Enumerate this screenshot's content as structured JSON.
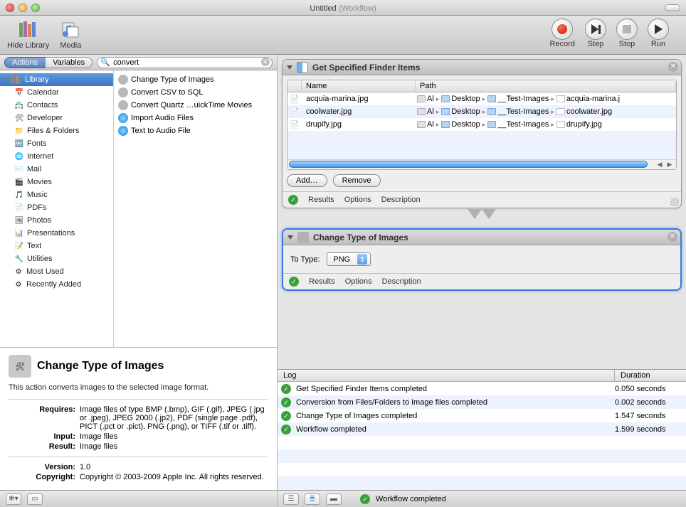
{
  "window": {
    "title": "Untitled",
    "subtitle": "(Workflow)"
  },
  "toolbar": {
    "hide_library": "Hide Library",
    "media": "Media",
    "record": "Record",
    "step": "Step",
    "stop": "Stop",
    "run": "Run"
  },
  "library_tabs": {
    "actions": "Actions",
    "variables": "Variables"
  },
  "search": {
    "placeholder": "",
    "value": "convert"
  },
  "categories": {
    "root": "Library",
    "items": [
      "Calendar",
      "Contacts",
      "Developer",
      "Files & Folders",
      "Fonts",
      "Internet",
      "Mail",
      "Movies",
      "Music",
      "PDFs",
      "Photos",
      "Presentations",
      "Text",
      "Utilities"
    ],
    "most_used": "Most Used",
    "recent": "Recently Added"
  },
  "actions_list": [
    "Change Type of Images",
    "Convert CSV to SQL",
    "Convert Quartz …uickTime Movies",
    "Import Audio Files",
    "Text to Audio File"
  ],
  "detail": {
    "title": "Change Type of Images",
    "desc": "This action converts images to the selected image format.",
    "requires_label": "Requires:",
    "requires": "Image files of type BMP (.bmp), GIF (.gif), JPEG (.jpg or .jpeg), JPEG 2000 (.jp2), PDF (single page .pdf), PICT (.pct or .pict), PNG (.png), or TIFF (.tif or .tiff).",
    "input_label": "Input:",
    "input": "Image files",
    "result_label": "Result:",
    "result": "Image files",
    "version_label": "Version:",
    "version": "1.0",
    "copyright_label": "Copyright:",
    "copyright": "Copyright © 2003-2009 Apple Inc.  All rights reserved."
  },
  "workflow": {
    "step1": {
      "title": "Get Specified Finder Items",
      "cols": {
        "name": "Name",
        "path": "Path"
      },
      "rows": [
        {
          "name": "acquia-marina.jpg",
          "path": [
            "Al",
            "Desktop",
            "__Test-Images"
          ],
          "file": "acquia-marina.j"
        },
        {
          "name": "coolwater.jpg",
          "path": [
            "Al",
            "Desktop",
            "__Test-Images"
          ],
          "file": "coolwater.jpg"
        },
        {
          "name": "drupify.jpg",
          "path": [
            "Al",
            "Desktop",
            "__Test-Images"
          ],
          "file": "drupify.jpg"
        }
      ],
      "add": "Add…",
      "remove": "Remove",
      "results": "Results",
      "options": "Options",
      "description": "Description"
    },
    "step2": {
      "title": "Change Type of Images",
      "to_type_label": "To Type:",
      "to_type_value": "PNG",
      "results": "Results",
      "options": "Options",
      "description": "Description"
    }
  },
  "log": {
    "head_log": "Log",
    "head_dur": "Duration",
    "rows": [
      {
        "msg": "Get Specified Finder Items completed",
        "dur": "0.050 seconds"
      },
      {
        "msg": "Conversion from Files/Folders to Image files completed",
        "dur": "0.002 seconds"
      },
      {
        "msg": "Change Type of Images completed",
        "dur": "1.547 seconds"
      },
      {
        "msg": "Workflow completed",
        "dur": "1.599 seconds"
      }
    ]
  },
  "statusbar": {
    "msg": "Workflow completed"
  }
}
